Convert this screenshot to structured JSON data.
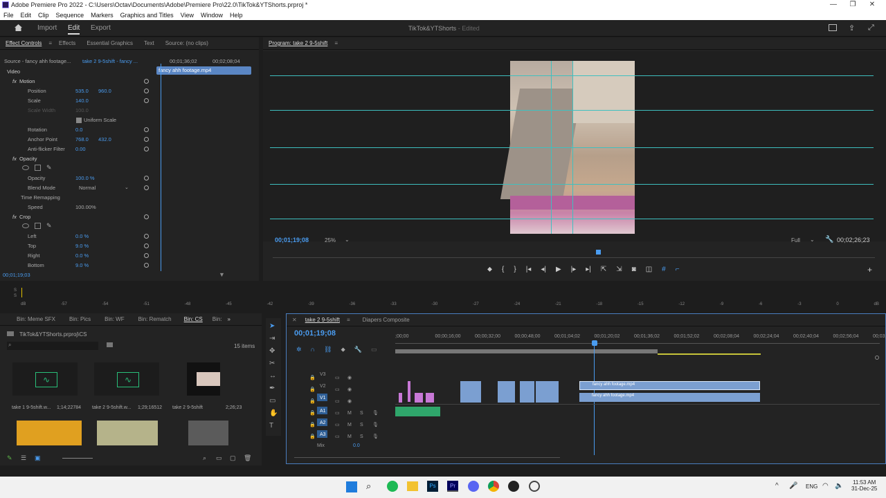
{
  "window": {
    "title": "Adobe Premiere Pro 2022 - C:\\Users\\Octav\\Documents\\Adobe\\Premiere Pro\\22.0\\TikTok&YTShorts.prproj *"
  },
  "menu": [
    "File",
    "Edit",
    "Clip",
    "Sequence",
    "Markers",
    "Graphics and Titles",
    "View",
    "Window",
    "Help"
  ],
  "header": {
    "tabs": [
      "Import",
      "Edit",
      "Export"
    ],
    "project_name": "TikTok&YTShorts",
    "status": "Edited"
  },
  "left_panel": {
    "tabs": [
      "Effect Controls",
      "Effects",
      "Essential Graphics",
      "Text",
      "Source: (no clips)"
    ],
    "source_label": "Source - fancy ahh footage...",
    "seq_label": "take 2 9-5shift - fancy ...",
    "ruler": [
      "00;01;36;02",
      "00;02;08;04"
    ],
    "clip_name": "fancy ahh footage.mp4",
    "video_label": "Video",
    "motion": "Motion",
    "position": {
      "label": "Position",
      "x": "535.0",
      "y": "960.0"
    },
    "scale": {
      "label": "Scale",
      "v": "140.0"
    },
    "scale_width": {
      "label": "Scale Width",
      "v": "100.0"
    },
    "uniform": "Uniform Scale",
    "rotation": {
      "label": "Rotation",
      "v": "0.0"
    },
    "anchor": {
      "label": "Anchor Point",
      "x": "768.0",
      "y": "432.0"
    },
    "antiflicker": {
      "label": "Anti-flicker Filter",
      "v": "0.00"
    },
    "opacity_group": "Opacity",
    "opacity": {
      "label": "Opacity",
      "v": "100.0 %"
    },
    "blend": {
      "label": "Blend Mode",
      "v": "Normal"
    },
    "time_remap": "Time Remapping",
    "speed": {
      "label": "Speed",
      "v": "100.00%"
    },
    "crop": "Crop",
    "left": {
      "label": "Left",
      "v": "0.0 %"
    },
    "top": {
      "label": "Top",
      "v": "9.0 %"
    },
    "right": {
      "label": "Right",
      "v": "0.0 %"
    },
    "bottom": {
      "label": "Bottom",
      "v": "9.0 %"
    },
    "timecode": "00;01;19;03"
  },
  "program": {
    "title": "Program: take 2 9-5shift",
    "timecode": "00;01;19;08",
    "zoom": "25%",
    "quality": "Full",
    "duration": "00;02;26;23"
  },
  "meter_scale": [
    "dB",
    "-57",
    "-54",
    "-51",
    "-48",
    "-45",
    "-42",
    "-39",
    "-36",
    "-33",
    "-30",
    "-27",
    "-24",
    "-21",
    "-18",
    "-15",
    "-12",
    "-9",
    "-6",
    "-3",
    "0",
    "dB"
  ],
  "project": {
    "bins": [
      "Bin: Meme SFX",
      "Bin: Pics",
      "Bin: WF",
      "Bin: Rematch",
      "Bin: CS",
      "Bin:"
    ],
    "path": "TikTok&YTShorts.prproj\\CS",
    "items_count": "15 items",
    "items": [
      {
        "name": "take 1 9-5shift.w...",
        "dur": "1;14;22784"
      },
      {
        "name": "take 2 9-5shift.w...",
        "dur": "1;29;16512"
      },
      {
        "name": "take 2 9-5shift",
        "dur": "2;26;23"
      }
    ]
  },
  "timeline": {
    "tabs": [
      "take 2 9-5shift",
      "Diapers Composite"
    ],
    "timecode": "00;01;19;08",
    "ruler": [
      ";00;00",
      "00;00;16;00",
      "00;00;32;00",
      "00;00;48;00",
      "00;01;04;02",
      "00;01;20;02",
      "00;01;36;02",
      "00;01;52;02",
      "00;02;08;04",
      "00;02;24;04",
      "00;02;40;04",
      "00;02;56;04",
      "00;03;"
    ],
    "tracks": [
      "V3",
      "V2",
      "V1",
      "A1",
      "A2",
      "A3"
    ],
    "mix_label": "Mix",
    "mix_value": "0.0",
    "clip_v2": "fancy ahh footage.mp4",
    "clip_v1": "fancy ahh footage.mp4"
  },
  "taskbar": {
    "lang": "ENG",
    "time": "11:53 AM",
    "date": "31-Dec-25"
  }
}
